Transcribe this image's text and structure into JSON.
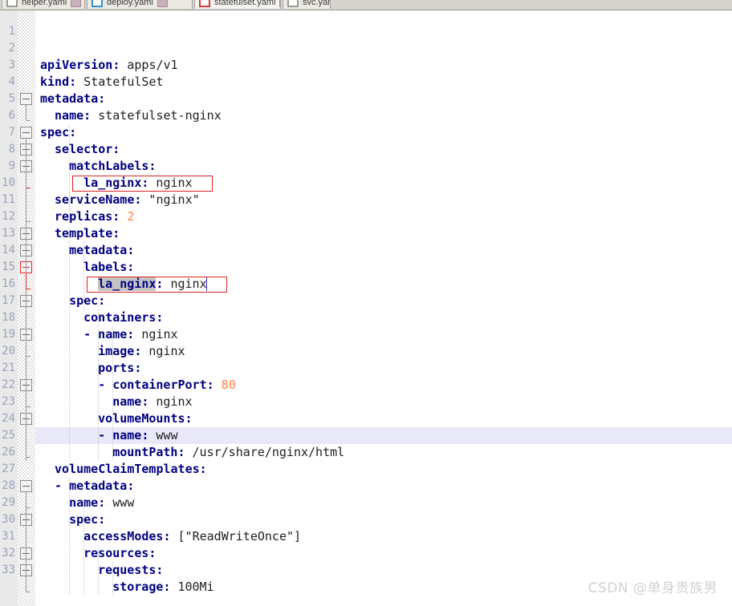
{
  "window": {
    "title": "statefulset.yaml"
  },
  "tabs": [
    {
      "label": "helper.yaml",
      "icon": "gray-file-icon",
      "active": false,
      "closable": true
    },
    {
      "label": "deploy.yaml",
      "icon": "blue-file-icon",
      "active": false,
      "closable": true
    },
    {
      "label": "statefulset.yaml",
      "icon": "red-file-icon",
      "active": true,
      "closable": true
    },
    {
      "label": "svc.yaml",
      "icon": "gray-file-icon",
      "active": false,
      "closable": true
    }
  ],
  "editor": {
    "language": "yaml",
    "current_line": 24,
    "line_number_start": 1,
    "line_number_end": 33,
    "line_numbers": [
      "1",
      "2",
      "3",
      "4",
      "5",
      "6",
      "7",
      "8",
      "9",
      "10",
      "11",
      "12",
      "13",
      "14",
      "15",
      "16",
      "17",
      "18",
      "19",
      "20",
      "21",
      "22",
      "23",
      "24",
      "25",
      "26",
      "27",
      "28",
      "29",
      "30",
      "31",
      "32",
      "33"
    ],
    "colors": {
      "key": "#000080",
      "value": "#202020",
      "number": "#ff8040",
      "current_line_bg": "#e8e8f8",
      "selection_bg": "#c3c3c3",
      "annotation_border": "#e02020",
      "gutter_bg": "#e9e9e9",
      "linenum_fg": "#9aa3b8",
      "caret": "#3b2ec0"
    },
    "lines": [
      {
        "n": 1,
        "indent": 0,
        "tokens": []
      },
      {
        "n": 2,
        "indent": 0,
        "tokens": [
          {
            "t": "key",
            "s": "apiVersion"
          },
          {
            "t": "punc",
            "s": ":"
          },
          {
            "t": "val",
            "s": " apps/v1"
          }
        ]
      },
      {
        "n": 3,
        "indent": 0,
        "tokens": [
          {
            "t": "key",
            "s": "kind"
          },
          {
            "t": "punc",
            "s": ":"
          },
          {
            "t": "val",
            "s": " StatefulSet"
          }
        ]
      },
      {
        "n": 4,
        "indent": 0,
        "tokens": [
          {
            "t": "key",
            "s": "metadata"
          },
          {
            "t": "punc",
            "s": ":"
          }
        ]
      },
      {
        "n": 5,
        "indent": 1,
        "tokens": [
          {
            "t": "key",
            "s": "name"
          },
          {
            "t": "punc",
            "s": ":"
          },
          {
            "t": "val",
            "s": " statefulset-nginx"
          }
        ]
      },
      {
        "n": 6,
        "indent": 0,
        "tokens": [
          {
            "t": "key",
            "s": "spec"
          },
          {
            "t": "punc",
            "s": ":"
          }
        ]
      },
      {
        "n": 7,
        "indent": 1,
        "tokens": [
          {
            "t": "key",
            "s": "selector"
          },
          {
            "t": "punc",
            "s": ":"
          }
        ]
      },
      {
        "n": 8,
        "indent": 2,
        "tokens": [
          {
            "t": "key",
            "s": "matchLabels"
          },
          {
            "t": "punc",
            "s": ":"
          }
        ]
      },
      {
        "n": 9,
        "indent": 3,
        "tokens": [
          {
            "t": "key",
            "s": "la_nginx"
          },
          {
            "t": "punc",
            "s": ":"
          },
          {
            "t": "val",
            "s": " nginx"
          }
        ]
      },
      {
        "n": 10,
        "indent": 1,
        "tokens": [
          {
            "t": "key",
            "s": "serviceName"
          },
          {
            "t": "punc",
            "s": ":"
          },
          {
            "t": "val",
            "s": " \"nginx\""
          }
        ]
      },
      {
        "n": 11,
        "indent": 1,
        "tokens": [
          {
            "t": "key",
            "s": "replicas"
          },
          {
            "t": "punc",
            "s": ":"
          },
          {
            "t": "num",
            "s": " 2"
          }
        ]
      },
      {
        "n": 12,
        "indent": 1,
        "tokens": [
          {
            "t": "key",
            "s": "template"
          },
          {
            "t": "punc",
            "s": ":"
          }
        ]
      },
      {
        "n": 13,
        "indent": 2,
        "tokens": [
          {
            "t": "key",
            "s": "metadata"
          },
          {
            "t": "punc",
            "s": ":"
          }
        ]
      },
      {
        "n": 14,
        "indent": 3,
        "tokens": [
          {
            "t": "key",
            "s": "labels"
          },
          {
            "t": "punc",
            "s": ":"
          }
        ]
      },
      {
        "n": 15,
        "indent": 4,
        "tokens": [
          {
            "t": "key",
            "s": "la_nginx"
          },
          {
            "t": "punc",
            "s": ":"
          },
          {
            "t": "val",
            "s": " nginx"
          }
        ]
      },
      {
        "n": 16,
        "indent": 2,
        "tokens": [
          {
            "t": "key",
            "s": "spec"
          },
          {
            "t": "punc",
            "s": ":"
          }
        ]
      },
      {
        "n": 17,
        "indent": 3,
        "tokens": [
          {
            "t": "key",
            "s": "containers"
          },
          {
            "t": "punc",
            "s": ":"
          }
        ]
      },
      {
        "n": 18,
        "indent": 3,
        "tokens": [
          {
            "t": "key",
            "s": "- name"
          },
          {
            "t": "punc",
            "s": ":"
          },
          {
            "t": "val",
            "s": " nginx"
          }
        ]
      },
      {
        "n": 19,
        "indent": 4,
        "tokens": [
          {
            "t": "key",
            "s": "image"
          },
          {
            "t": "punc",
            "s": ":"
          },
          {
            "t": "val",
            "s": " nginx"
          }
        ]
      },
      {
        "n": 20,
        "indent": 4,
        "tokens": [
          {
            "t": "key",
            "s": "ports"
          },
          {
            "t": "punc",
            "s": ":"
          }
        ]
      },
      {
        "n": 21,
        "indent": 4,
        "tokens": [
          {
            "t": "key",
            "s": "- containerPort"
          },
          {
            "t": "punc",
            "s": ":"
          },
          {
            "t": "num",
            "s": " 80"
          }
        ]
      },
      {
        "n": 22,
        "indent": 5,
        "tokens": [
          {
            "t": "key",
            "s": "name"
          },
          {
            "t": "punc",
            "s": ":"
          },
          {
            "t": "val",
            "s": " nginx"
          }
        ]
      },
      {
        "n": 23,
        "indent": 4,
        "tokens": [
          {
            "t": "key",
            "s": "volumeMounts"
          },
          {
            "t": "punc",
            "s": ":"
          }
        ]
      },
      {
        "n": 24,
        "indent": 4,
        "tokens": [
          {
            "t": "key",
            "s": "- name"
          },
          {
            "t": "punc",
            "s": ":"
          },
          {
            "t": "val",
            "s": " www"
          }
        ]
      },
      {
        "n": 25,
        "indent": 5,
        "tokens": [
          {
            "t": "key",
            "s": "mountPath"
          },
          {
            "t": "punc",
            "s": ":"
          },
          {
            "t": "val",
            "s": " /usr/share/nginx/html"
          }
        ]
      },
      {
        "n": 26,
        "indent": 1,
        "tokens": [
          {
            "t": "key",
            "s": "volumeClaimTemplates"
          },
          {
            "t": "punc",
            "s": ":"
          }
        ]
      },
      {
        "n": 27,
        "indent": 1,
        "tokens": [
          {
            "t": "key",
            "s": "- metadata"
          },
          {
            "t": "punc",
            "s": ":"
          }
        ]
      },
      {
        "n": 28,
        "indent": 2,
        "tokens": [
          {
            "t": "key",
            "s": "name"
          },
          {
            "t": "punc",
            "s": ":"
          },
          {
            "t": "val",
            "s": " www"
          }
        ]
      },
      {
        "n": 29,
        "indent": 2,
        "tokens": [
          {
            "t": "key",
            "s": "spec"
          },
          {
            "t": "punc",
            "s": ":"
          }
        ]
      },
      {
        "n": 30,
        "indent": 3,
        "tokens": [
          {
            "t": "key",
            "s": "accessModes"
          },
          {
            "t": "punc",
            "s": ":"
          },
          {
            "t": "val",
            "s": " [\"ReadWriteOnce\"]"
          }
        ]
      },
      {
        "n": 31,
        "indent": 3,
        "tokens": [
          {
            "t": "key",
            "s": "resources"
          },
          {
            "t": "punc",
            "s": ":"
          }
        ]
      },
      {
        "n": 32,
        "indent": 4,
        "tokens": [
          {
            "t": "key",
            "s": "requests"
          },
          {
            "t": "punc",
            "s": ":"
          }
        ]
      },
      {
        "n": 33,
        "indent": 5,
        "tokens": [
          {
            "t": "key",
            "s": "storage"
          },
          {
            "t": "punc",
            "s": ":"
          },
          {
            "t": "val",
            "s": " 100Mi"
          }
        ]
      }
    ],
    "annotations": [
      {
        "name": "matchlabels-la-nginx-box",
        "line": 9,
        "label": "la_nginx: nginx"
      },
      {
        "name": "template-labels-la-nginx-box",
        "line": 15,
        "label": "la_nginx: nginx"
      }
    ],
    "selection": {
      "line": 15,
      "text": "la_nginx"
    },
    "caret": {
      "line": 15,
      "after_text": "nginx"
    },
    "fold_markers": [
      {
        "line": 4,
        "state": "expanded",
        "color": "gray"
      },
      {
        "line": 6,
        "state": "expanded",
        "color": "gray"
      },
      {
        "line": 7,
        "state": "expanded",
        "color": "gray"
      },
      {
        "line": 8,
        "state": "expanded",
        "color": "gray"
      },
      {
        "line": 12,
        "state": "expanded",
        "color": "gray"
      },
      {
        "line": 13,
        "state": "expanded",
        "color": "gray"
      },
      {
        "line": 14,
        "state": "expanded",
        "color": "red"
      },
      {
        "line": 16,
        "state": "expanded",
        "color": "gray"
      },
      {
        "line": 18,
        "state": "expanded",
        "color": "gray"
      },
      {
        "line": 21,
        "state": "expanded",
        "color": "gray"
      },
      {
        "line": 23,
        "state": "expanded",
        "color": "gray"
      },
      {
        "line": 27,
        "state": "expanded",
        "color": "gray"
      },
      {
        "line": 29,
        "state": "expanded",
        "color": "gray"
      },
      {
        "line": 31,
        "state": "expanded",
        "color": "gray"
      },
      {
        "line": 32,
        "state": "expanded",
        "color": "gray"
      }
    ]
  },
  "watermark": {
    "text": "CSDN @单身贵族男"
  }
}
